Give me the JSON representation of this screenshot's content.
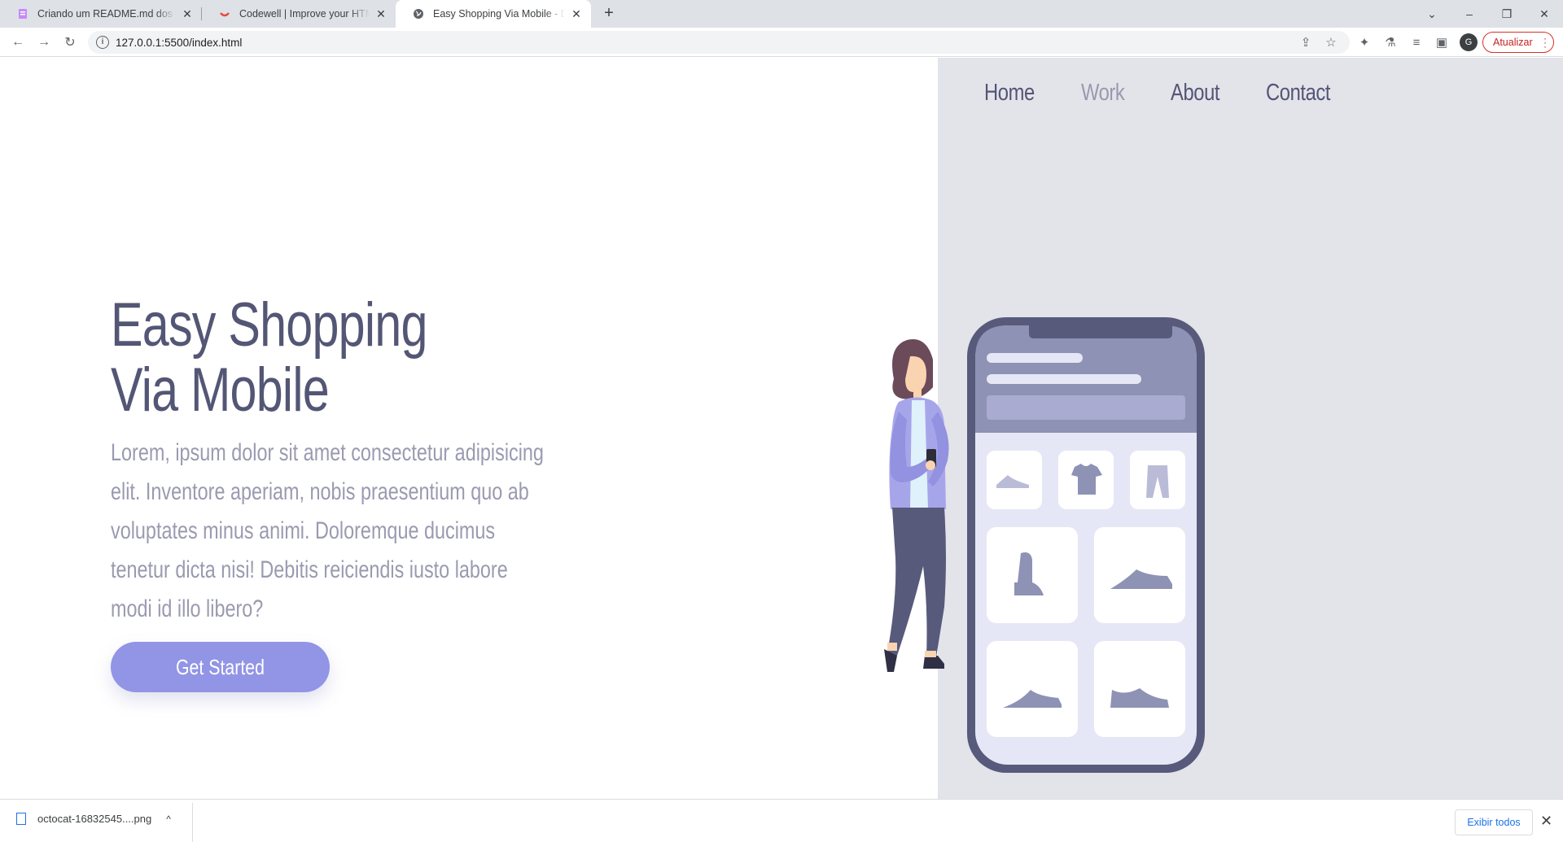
{
  "browser": {
    "tabs": [
      {
        "title": "Criando um README.md dos pro",
        "icon": "document-icon"
      },
      {
        "title": "Codewell | Improve your HTML, C",
        "icon": "codewell-icon"
      },
      {
        "title": "Easy Shopping Via Mobile - Deve",
        "icon": "globe-icon"
      }
    ],
    "address": "127.0.0.1:5500/index.html",
    "profile_initial": "G",
    "update_label": "Atualizar"
  },
  "nav": {
    "items": [
      "Home",
      "Work",
      "About",
      "Contact"
    ],
    "active": "Work"
  },
  "hero": {
    "title_line1": "Easy Shopping",
    "title_line2": "Via Mobile",
    "body": "Lorem, ipsum dolor sit amet consectetur adipisicing elit. Inventore aperiam, nobis praesentium quo ab voluptates minus animi. Doloremque ducimus tenetur dicta nisi! Debitis reiciendis iusto labore modi id illo libero?",
    "cta": "Get Started"
  },
  "downloads": {
    "file": "octocat-16832545....png",
    "show_all": "Exibir todos"
  },
  "colors": {
    "heading": "#545675",
    "body_text": "#9a9ab0",
    "accent": "#9294e5",
    "panel_bg": "#e3e3ea",
    "phone_frame": "#575a7b"
  }
}
